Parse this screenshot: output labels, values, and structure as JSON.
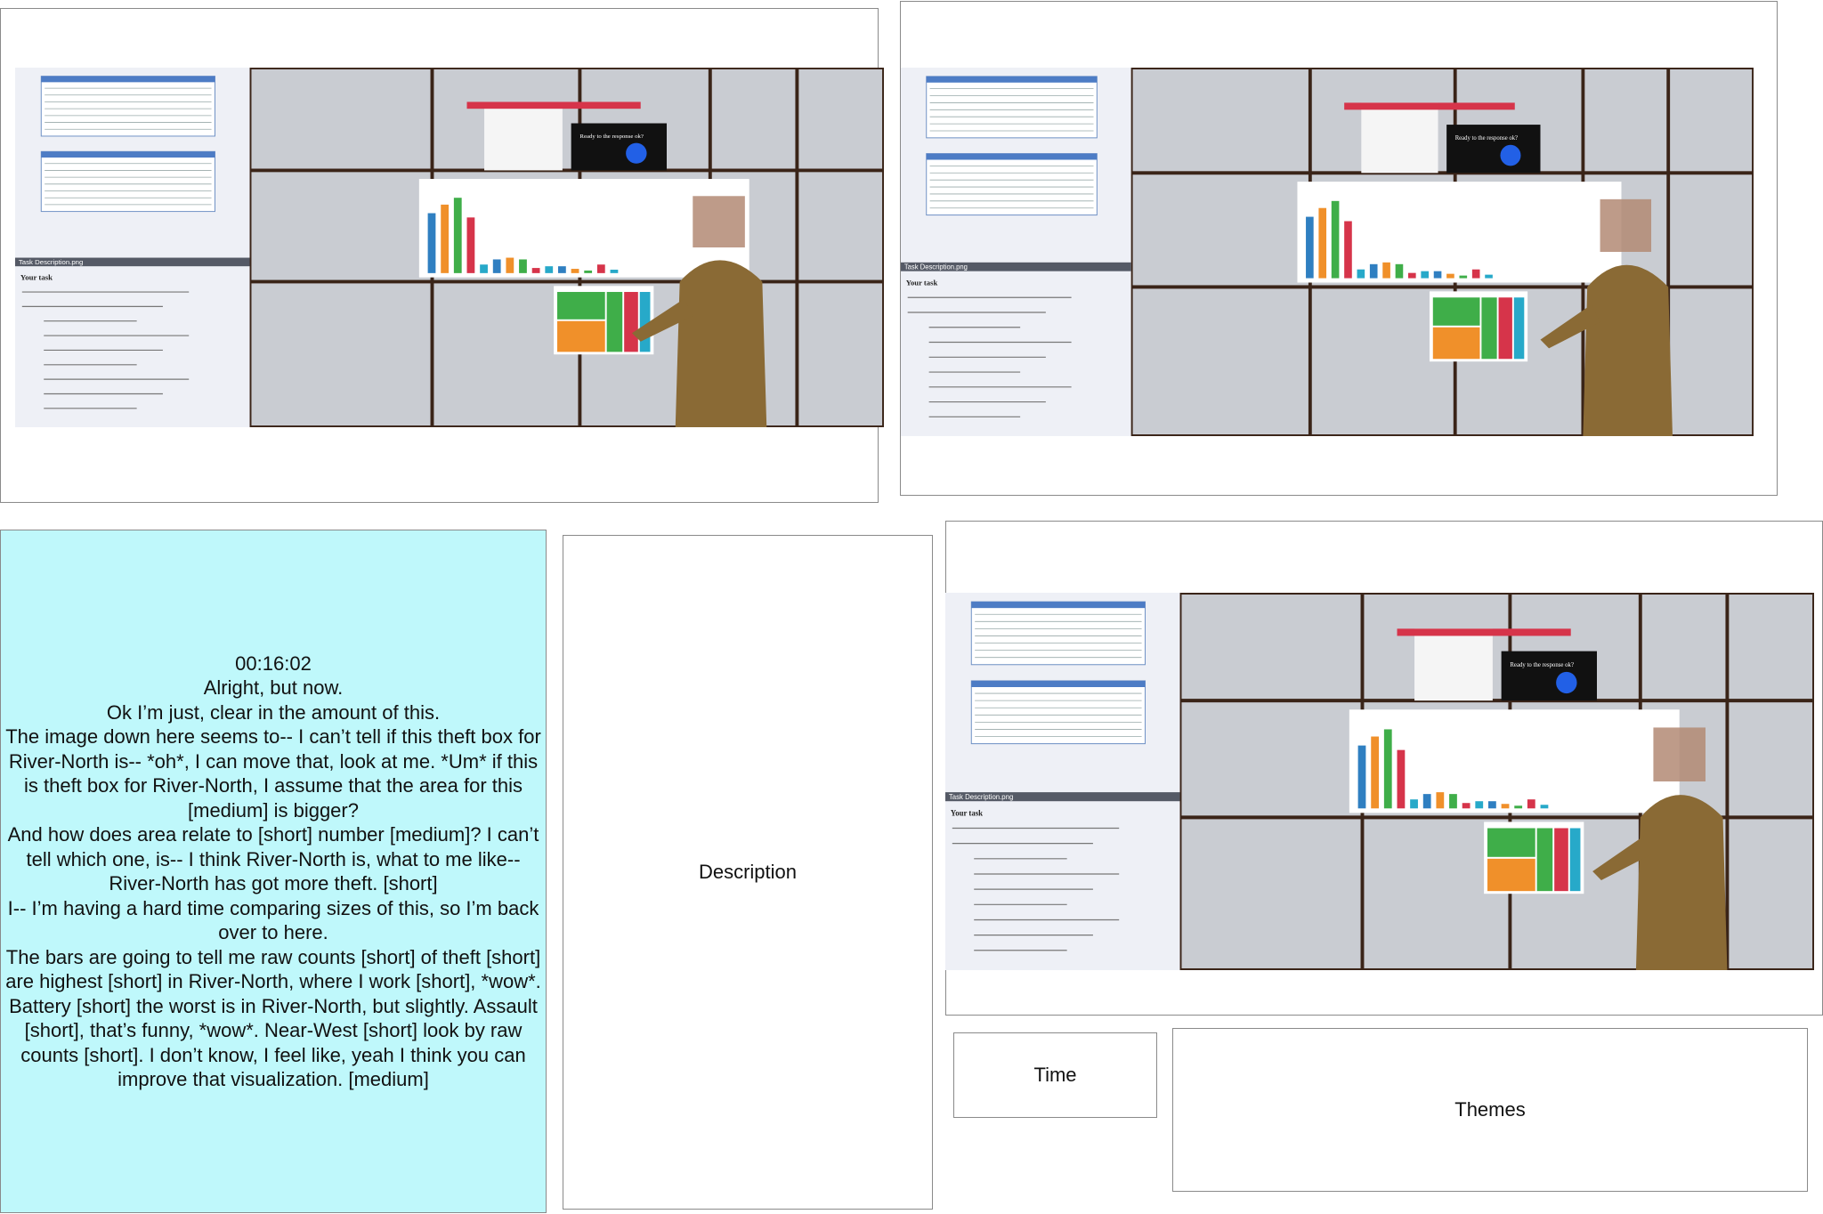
{
  "photos": [
    {
      "name": "photo-1",
      "window_title": "Task Description.png",
      "screen_heading": "Your task",
      "popup_text": "Ready to the response ok?"
    },
    {
      "name": "photo-2",
      "window_title": "Task Description.png",
      "screen_heading": "Your task",
      "popup_text": "Ready to the response ok?"
    },
    {
      "name": "photo-3",
      "window_title": "Task Description.png",
      "screen_heading": "Your task",
      "popup_text": "Ready to the response ok?"
    }
  ],
  "transcript": {
    "lines": [
      "00:16:02",
      "Alright, but now.",
      "Ok I’m just, clear in the amount of this.",
      "The image down here seems to-- I can’t tell if this theft box for River-North is-- *oh*, I can move that, look at me. *Um* if this is theft box for River-North, I assume that the area for this [medium] is bigger?",
      "And how does area relate to [short] number [medium]? I can’t tell which one, is-- I think River-North is, what to me like-- River-North has got more theft. [short]",
      "I-- I’m having a hard time comparing sizes of this, so I’m back over to here.",
      "The bars are going to tell me raw counts [short] of theft [short] are highest [short] in River-North, where I work [short], *wow*.",
      "Battery [short] the worst is in River-North, but slightly. Assault [short], that’s funny, *wow*. Near-West [short] look by raw counts [short]. I don’t know, I feel like, yeah I think you can improve that visualization. [medium]"
    ]
  },
  "labels": {
    "description": "Description",
    "time": "Time",
    "themes": "Themes"
  },
  "colors": {
    "transcript_bg": "#bff8fb",
    "bar_colors": [
      "#2f7fc1",
      "#f0902a",
      "#3fae49",
      "#d6344a",
      "#27a9c9"
    ]
  }
}
